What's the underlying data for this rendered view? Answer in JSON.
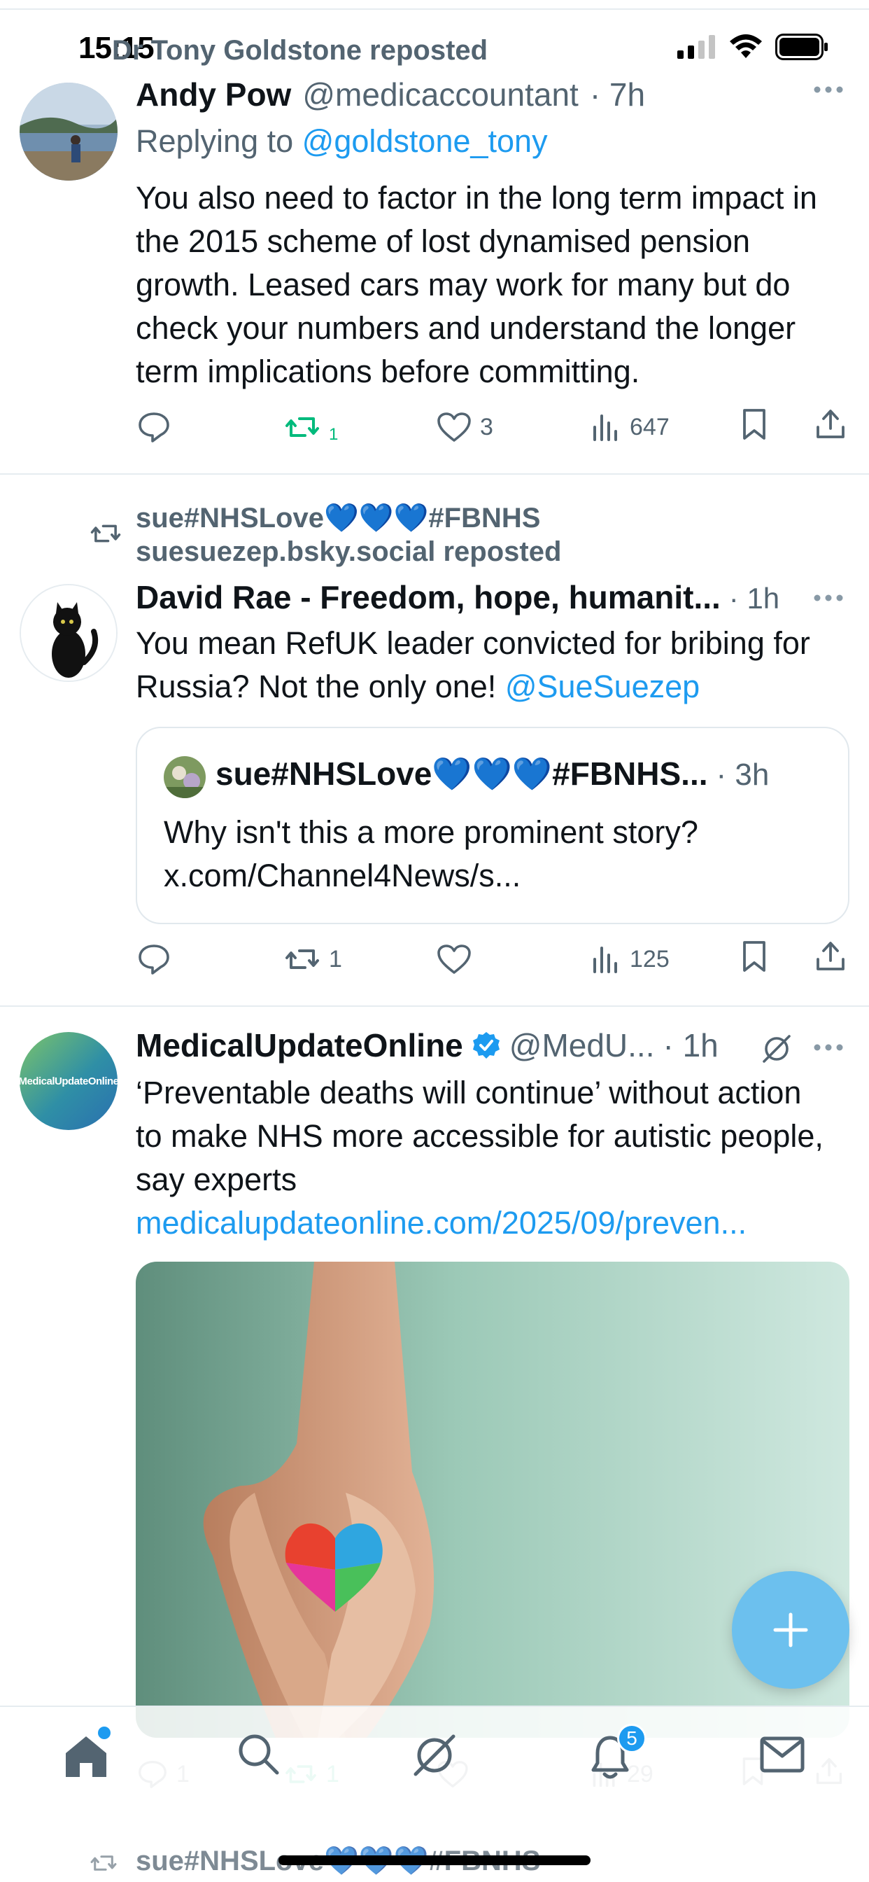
{
  "status_bar": {
    "time": "15:15"
  },
  "posts": [
    {
      "repost_by": "Dr Tony Goldstone reposted",
      "author_name": "Andy Pow",
      "author_handle": "@medicaccountant",
      "time": "· 7h",
      "reply_prefix": "Replying to",
      "reply_to": "@goldstone_tony",
      "text": "You also need to factor in the long term impact in the 2015 scheme of lost dynamised pension growth. Leased cars may work for many but do check your numbers and understand the longer term implications before committing.",
      "reposts": "1",
      "likes": "3",
      "views": "647"
    },
    {
      "repost_by_line1": "sue#NHSLove💙💙💙#FBNHS",
      "repost_by_line2": "suesuezep.bsky.social reposted",
      "author_name": "David Rae - Freedom, hope, humanit...",
      "time": "· 1h",
      "text": "You mean RefUK leader convicted for bribing for Russia? Not the only one!",
      "mention": "@SueSuezep",
      "quote": {
        "author_name": "sue#NHSLove💙💙💙#FBNHS...",
        "time": "· 3h",
        "text_line1": "Why isn't this a more prominent story?",
        "text_line2": "x.com/Channel4News/s..."
      },
      "reposts": "1",
      "likes": "",
      "views": "125"
    },
    {
      "author_name": "MedicalUpdateOnline",
      "author_handle": "@MedU...",
      "time": "· 1h",
      "avatar_text": "MedicalUpdateOnline",
      "text": "‘Preventable deaths will continue’ without action to make NHS more accessible for autistic people, say experts",
      "link": "medicalupdateonline.com/2025/09/preven...",
      "replies": "1",
      "reposts": "1",
      "likes": "",
      "views": "29"
    }
  ],
  "next_post_preview": {
    "repost_by": "sue#NHSLove💙💙💙#FBNHS"
  },
  "tab_bar": {
    "notifications_badge": "5"
  },
  "colors": {
    "accent": "#1d9bf0",
    "repost_green": "#00ba7c",
    "fab": "#6cc0ee"
  }
}
